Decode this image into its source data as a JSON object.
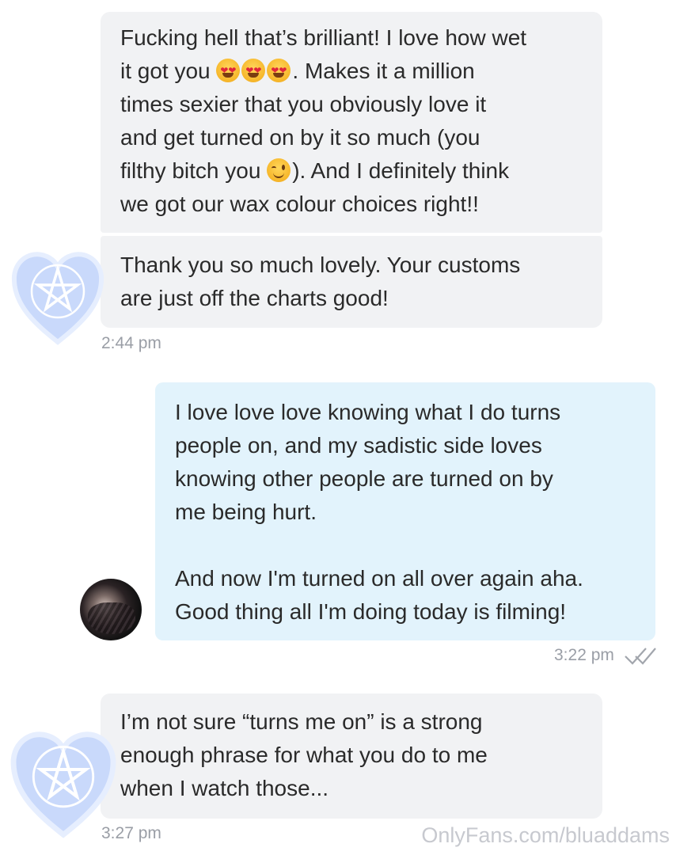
{
  "messages": [
    {
      "lines": [
        "Fucking hell that’s brilliant! I love how wet",
        "it got you",
        ". Makes it a million",
        "times sexier that you obviously love it",
        "and get turned on by it so much (you",
        "filthy bitch you",
        "). And I definitely think",
        "we got our wax colour choices right!!"
      ]
    },
    {
      "lines": [
        "Thank you so much lovely. Your customs",
        "are just off the charts good!"
      ],
      "time": "2:44 pm"
    },
    {
      "lines": [
        "I love love love knowing what I do turns",
        "people on, and my sadistic side loves",
        "knowing other people are turned on by",
        "me being hurt.",
        "And now I'm turned on all over again aha.",
        "Good thing all I'm doing today is filming!"
      ],
      "time": "3:22 pm"
    },
    {
      "lines": [
        "I’m not sure “turns me on” is a strong",
        "enough phrase for what you do to me",
        "when I watch those..."
      ],
      "time": "3:27 pm"
    }
  ],
  "icons": {
    "heart_eyes": "heart-eyes-emoji",
    "wink": "winking-face-emoji",
    "read": "double-check-icon",
    "sender_avatar": "pentagram-heart-avatar"
  },
  "colors": {
    "incoming": "#f1f2f4",
    "outgoing": "#e2f3fc",
    "time": "#9a9ea6"
  },
  "watermark": "OnlyFans.com/bluaddams"
}
